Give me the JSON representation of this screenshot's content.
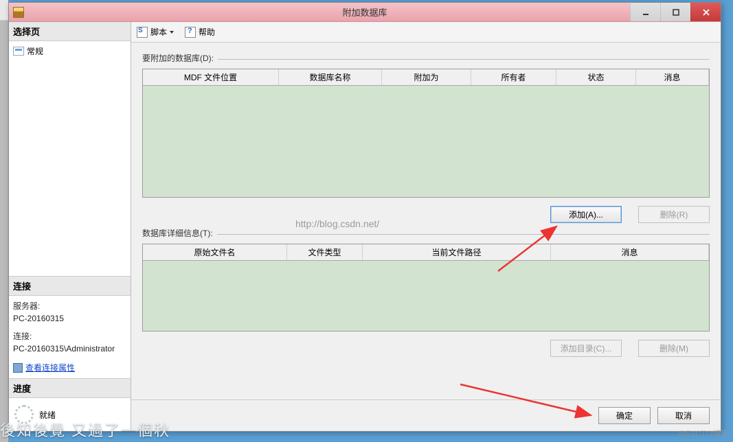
{
  "title": "附加数据库",
  "sidebar": {
    "select_page_label": "选择页",
    "general_label": "常规",
    "connection_label": "连接",
    "server_label": "服务器:",
    "server_value": "PC-20160315",
    "conn_label": "连接:",
    "conn_value": "PC-20160315\\Administrator",
    "view_props_link": "查看连接属性",
    "progress_label": "进度",
    "ready_label": "就绪"
  },
  "toolbar": {
    "script_label": "脚本",
    "help_label": "帮助"
  },
  "main": {
    "attach_db_label": "要附加的数据库(D):",
    "grid1_headers": {
      "c1": "MDF 文件位置",
      "c2": "数据库名称",
      "c3": "附加为",
      "c4": "所有者",
      "c5": "状态",
      "c6": "消息"
    },
    "add_button": "添加(A)...",
    "remove_button": "删除(R)",
    "details_label": "数据库详细信息(T):",
    "grid2_headers": {
      "c1": "原始文件名",
      "c2": "文件类型",
      "c3": "当前文件路径",
      "c4": "消息"
    },
    "add_catalog_button": "添加目录(C)...",
    "remove2_button": "删除(M)"
  },
  "dialog": {
    "ok": "确定",
    "cancel": "取消"
  },
  "watermark": "http://blog.csdn.net/",
  "bottom_text": "後知後覺  又過了一個秋",
  "wm_right": "@51CTO博客"
}
